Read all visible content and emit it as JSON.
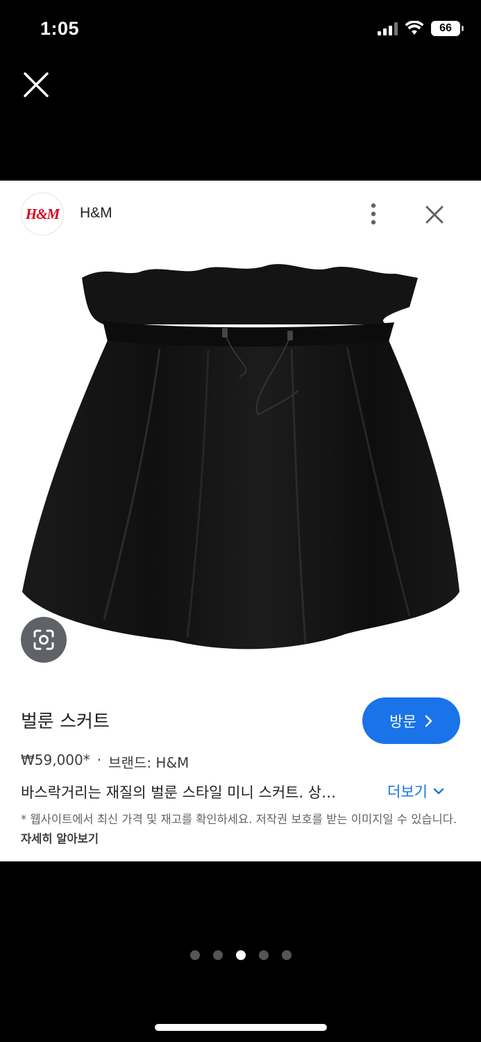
{
  "status": {
    "time": "1:05",
    "battery": "66"
  },
  "card": {
    "brand_logo_text": "H&M",
    "brand_name": "H&M",
    "title": "벌룬 스커트",
    "visit_label": "방문",
    "price": "₩59,000*",
    "separator": "·",
    "brand_line": "브랜드: H&M",
    "description": "바스락거리는 재질의 벌룬 스타일 미니 스커트. 상…",
    "more_label": "더보기",
    "notice": "* 웹사이트에서 최신 가격 및 재고를 확인하세요. 저작권 보호를 받는 이미지일 수 있습니다.",
    "learn_more": "자세히 알아보기"
  },
  "carousel": {
    "count": 5,
    "active_index": 2
  },
  "colors": {
    "accent": "#1a73e8",
    "brand": "#d6001c"
  }
}
